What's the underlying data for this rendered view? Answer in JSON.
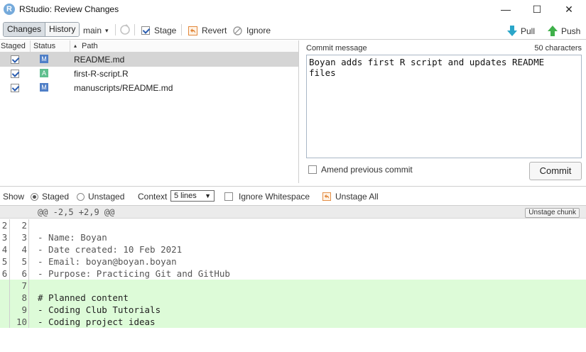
{
  "window": {
    "logo_letter": "R",
    "title": "RStudio: Review Changes",
    "minimize": "—",
    "maximize": "☐",
    "close": "✕"
  },
  "toolbar": {
    "tabs": [
      {
        "label": "Changes",
        "active": true
      },
      {
        "label": "History",
        "active": false
      }
    ],
    "branch": "main",
    "branch_arrow": "▾",
    "stage_label": "Stage",
    "revert_label": "Revert",
    "ignore_label": "Ignore",
    "pull_label": "Pull",
    "push_label": "Push"
  },
  "files": {
    "headers": {
      "staged": "Staged",
      "status": "Status",
      "path": "Path",
      "sort_arrow": "▴"
    },
    "rows": [
      {
        "staged": true,
        "status": "M",
        "status_color": "#4f7fc7",
        "path": "README.md",
        "selected": true
      },
      {
        "staged": true,
        "status": "A",
        "status_color": "#5fbf8f",
        "path": "first-R-script.R",
        "selected": false
      },
      {
        "staged": true,
        "status": "M",
        "status_color": "#4f7fc7",
        "path": "manuscripts/README.md",
        "selected": false
      }
    ]
  },
  "commit": {
    "label": "Commit message",
    "char_count": "50 characters",
    "message": "Boyan adds first R script and updates README\nfiles",
    "amend_label": "Amend previous commit",
    "amend_checked": false,
    "button_label": "Commit"
  },
  "diff_toolbar": {
    "show_label": "Show",
    "staged_label": "Staged",
    "unstaged_label": "Unstaged",
    "staged_selected": true,
    "context_label": "Context",
    "context_value": "5 lines",
    "context_arrow": "▼",
    "ignore_ws_label": "Ignore Whitespace",
    "ignore_ws_checked": false,
    "unstage_all_label": "Unstage All"
  },
  "diff": {
    "hunk_header": "@@ -2,5 +2,9 @@",
    "unstage_chunk_label": "Unstage chunk",
    "lines": [
      {
        "old": "2",
        "new": "2",
        "text": "",
        "type": "context"
      },
      {
        "old": "3",
        "new": "3",
        "text": "- Name: Boyan",
        "type": "context"
      },
      {
        "old": "4",
        "new": "4",
        "text": "- Date created: 10 Feb 2021",
        "type": "context"
      },
      {
        "old": "5",
        "new": "5",
        "text": "- Email: boyan@boyan.boyan",
        "type": "context"
      },
      {
        "old": "6",
        "new": "6",
        "text": "- Purpose: Practicing Git and GitHub",
        "type": "context"
      },
      {
        "old": "",
        "new": "7",
        "text": "",
        "type": "added"
      },
      {
        "old": "",
        "new": "8",
        "text": "# Planned content",
        "type": "added"
      },
      {
        "old": "",
        "new": "9",
        "text": "- Coding Club Tutorials",
        "type": "added"
      },
      {
        "old": "",
        "new": "10",
        "text": "- Coding project ideas",
        "type": "added"
      }
    ]
  },
  "colors": {
    "added_bg": "#ddfbd8",
    "selected_row": "#d5d5d5",
    "pull_icon": "#2aa6c9",
    "push_icon": "#3fb04a",
    "revert_icon": "#e2873a"
  }
}
